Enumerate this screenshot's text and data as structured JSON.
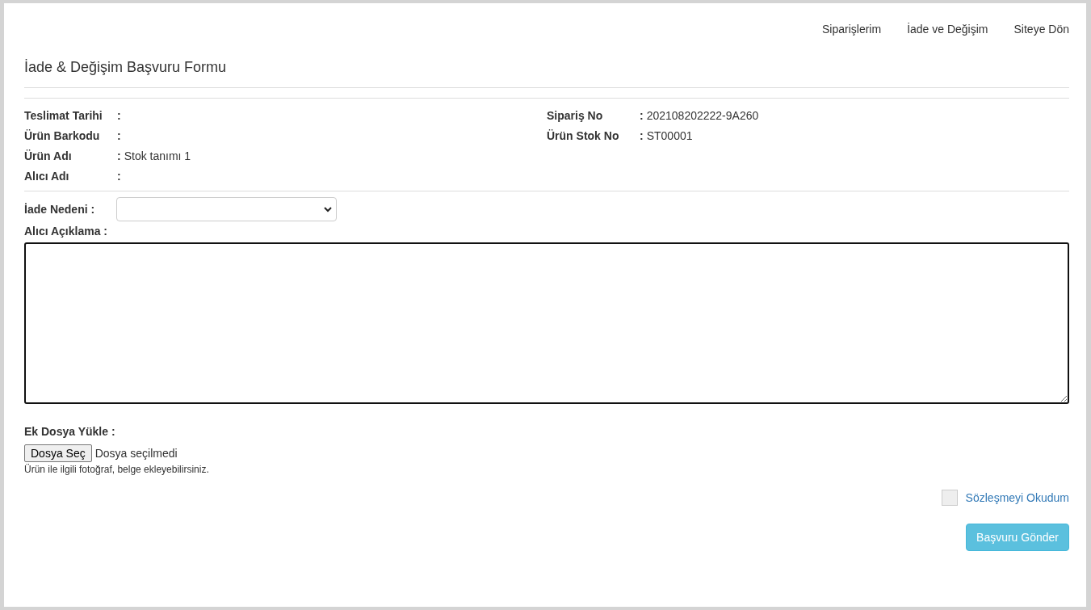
{
  "nav": [
    "Siparişlerim",
    "İade ve Değişim",
    "Siteye Dön"
  ],
  "title": "İade & Değişim Başvuru Formu",
  "details_left": [
    {
      "label": "Teslimat Tarihi",
      "separator": ":"
    },
    {
      "label": "Ürün Barkodu",
      "separator": ":"
    },
    {
      "label": "Ürün Adı",
      "separator": ":",
      "value": "Stok tanımı 1"
    },
    {
      "label": "Alıcı Adı",
      "separator": ":"
    }
  ],
  "details_right": [
    {
      "label": "Sipariş No",
      "separator": ":",
      "value": "202108202222-9A260"
    },
    {
      "label": "Ürün Stok No",
      "separator": ":",
      "value": "ST00001"
    }
  ],
  "reason": {
    "label": "İade Nedeni :"
  },
  "comment": {
    "label": "Alıcı Açıklama :"
  },
  "upload": {
    "label": "Ek Dosya Yükle :",
    "button": "Dosya Seç",
    "status": "Dosya seçilmedi",
    "hint": "Ürün ile ilgili fotoğraf, belge ekleyebilirsiniz."
  },
  "agreement": {
    "label": "Sözleşmeyi Okudum",
    "checked": false
  },
  "submit": "Başvuru Gönder"
}
